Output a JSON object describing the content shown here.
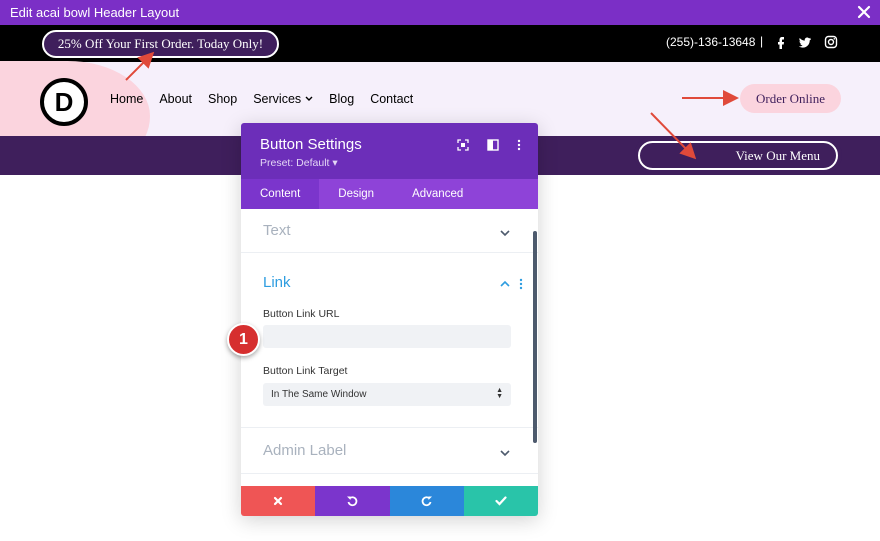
{
  "titlebar": {
    "title": "Edit acai bowl Header Layout"
  },
  "header_preview": {
    "promo_text": "25% Off Your First Order. Today Only!",
    "phone": "(255)-136-13648",
    "separator": "|",
    "social_icons": [
      "facebook-icon",
      "twitter-icon",
      "instagram-icon"
    ],
    "logo_letter": "D",
    "nav": [
      "Home",
      "About",
      "Shop",
      "Services",
      "Blog",
      "Contact"
    ],
    "order_button": "Order Online",
    "menu_button": "View Our Menu"
  },
  "panel": {
    "title": "Button Settings",
    "preset": "Preset: Default",
    "tabs": [
      "Content",
      "Design",
      "Advanced"
    ],
    "active_tab": "Content",
    "sections": {
      "text": "Text",
      "link": "Link",
      "admin_label": "Admin Label"
    },
    "link": {
      "url_label": "Button Link URL",
      "url_value": "",
      "target_label": "Button Link Target",
      "target_value": "In The Same Window"
    }
  },
  "annotation": {
    "badge_number": "1"
  },
  "colors": {
    "titlebar": "#7b2fc6",
    "panel_header": "#6c2eb9",
    "tabs": "#8e43d8",
    "link_blue": "#2e9de0",
    "cancel": "#ef5555",
    "undo": "#7b35cc",
    "redo": "#2b87da",
    "save": "#29c4a9",
    "badge": "#d62f2f",
    "arrow": "#e04a3a"
  }
}
